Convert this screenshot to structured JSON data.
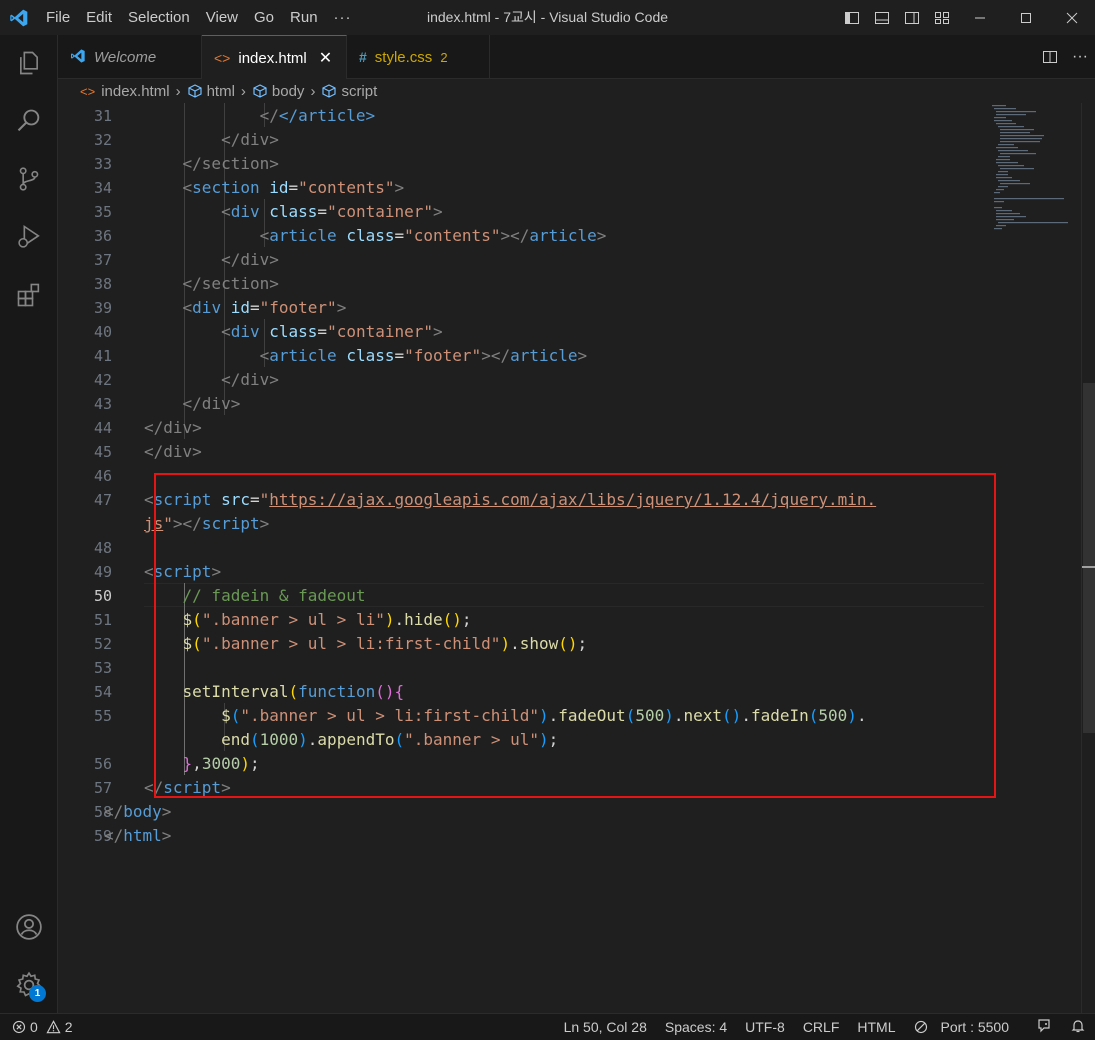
{
  "window": {
    "title": "index.html - 7교시 - Visual Studio Code",
    "menu": [
      "File",
      "Edit",
      "Selection",
      "View",
      "Go",
      "Run",
      "···"
    ]
  },
  "tabs": [
    {
      "label": "Welcome",
      "icon": "vscode-icon"
    },
    {
      "label": "index.html",
      "icon": "html-icon",
      "close": "✕"
    },
    {
      "label": "style.css",
      "icon": "css-icon",
      "problems": "2"
    }
  ],
  "breadcrumb": {
    "file": "index.html",
    "items": [
      "html",
      "body",
      "script"
    ]
  },
  "activity": {
    "settings_badge": "1"
  },
  "editor": {
    "line_numbers": [
      "31",
      "32",
      "33",
      "34",
      "35",
      "36",
      "37",
      "38",
      "39",
      "40",
      "41",
      "42",
      "43",
      "44",
      "45",
      "46",
      "47",
      "",
      "48",
      "49",
      "50",
      "51",
      "52",
      "53",
      "54",
      "55",
      "",
      "56",
      "57",
      "58",
      "59"
    ],
    "code": {
      "l31_close_article": "</article>",
      "l32": "</div>",
      "l33": "</section>",
      "l34_tag": "section",
      "l34_attr": "id",
      "l34_val": "\"contents\"",
      "l35_tag": "div",
      "l35_attr": "class",
      "l35_val": "\"container\"",
      "l36_tag": "article",
      "l36_attr": "class",
      "l36_val": "\"contents\"",
      "l37": "</div>",
      "l38": "</section>",
      "l39_tag": "div",
      "l39_attr": "id",
      "l39_val": "\"footer\"",
      "l40_tag": "div",
      "l40_attr": "class",
      "l40_val": "\"container\"",
      "l41_tag": "article",
      "l41_attr": "class",
      "l41_val": "\"footer\"",
      "l42": "</div>",
      "l43": "</div>",
      "l44": "</div>",
      "l45": "</div>",
      "l47_tag": "script",
      "l47_attr": "src",
      "l47_url1": "https://ajax.googleapis.com/ajax/libs/jquery/1.12.4/jquery.min.",
      "l47_url2": "js",
      "l49_tag": "script",
      "l50_comment": "// fadein & fadeout",
      "l51_str": "\".banner > ul > li\"",
      "l51_fn": "hide",
      "l52_str": "\".banner > ul > li:first-child\"",
      "l52_fn": "show",
      "l54_fn": "setInterval",
      "l54_kw": "function",
      "l55_str": "\".banner > ul > li:first-child\"",
      "l55_fn1": "fadeOut",
      "l55_n1": "500",
      "l55_fn2": "next",
      "l55_fn3": "fadeIn",
      "l55_n2": "500",
      "l55b_fn1": "end",
      "l55b_n": "1000",
      "l55b_fn2": "appendTo",
      "l55b_str": "\".banner > ul\"",
      "l56_n": "3000",
      "l57_tag": "script",
      "l58_tag": "body",
      "l59_tag": "html"
    }
  },
  "status": {
    "errors": "0",
    "warnings": "2",
    "position": "Ln 50, Col 28",
    "spaces": "Spaces: 4",
    "encoding": "UTF-8",
    "eol": "CRLF",
    "language": "HTML",
    "port": "Port : 5500"
  },
  "colors": {
    "accent": "#0078d4",
    "highlight_box": "#e51515",
    "editor_bg": "#1f1f1f"
  }
}
